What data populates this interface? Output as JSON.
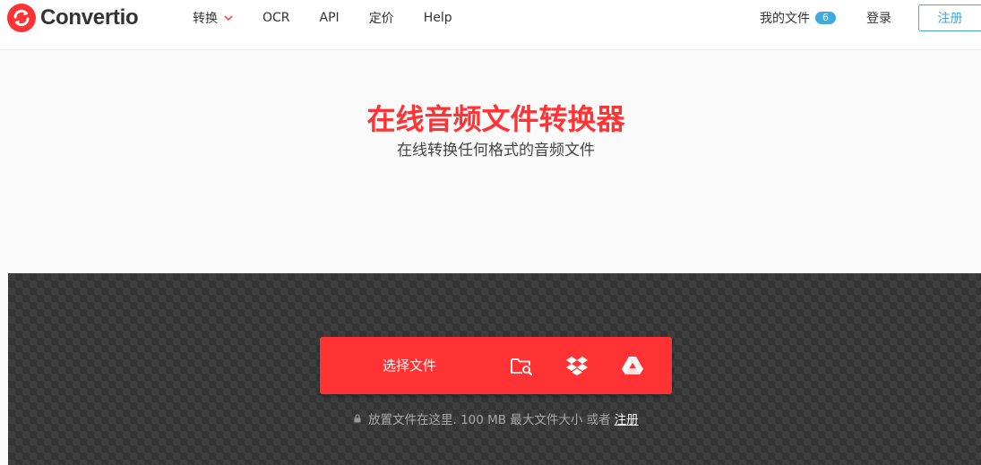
{
  "brand": {
    "name": "Convertio",
    "accent": "#ff3333",
    "link": "#3fa9e0"
  },
  "nav": {
    "items": [
      {
        "label": "转换",
        "has_dropdown": true
      },
      {
        "label": "OCR"
      },
      {
        "label": "API"
      },
      {
        "label": "定价"
      },
      {
        "label": "Help"
      }
    ]
  },
  "account": {
    "my_files_label": "我的文件",
    "my_files_count": "6",
    "login_label": "登录",
    "signup_label": "注册"
  },
  "hero": {
    "title": "在线音频文件转换器",
    "subtitle": "在线转换任何格式的音频文件"
  },
  "upload": {
    "choose_label": "选择文件",
    "sources": [
      "local-folder-search-icon",
      "dropbox-icon",
      "google-drive-icon"
    ],
    "note": "放置文件在这里. 100 MB 最大文件大小 或者",
    "note_link": "注册"
  }
}
